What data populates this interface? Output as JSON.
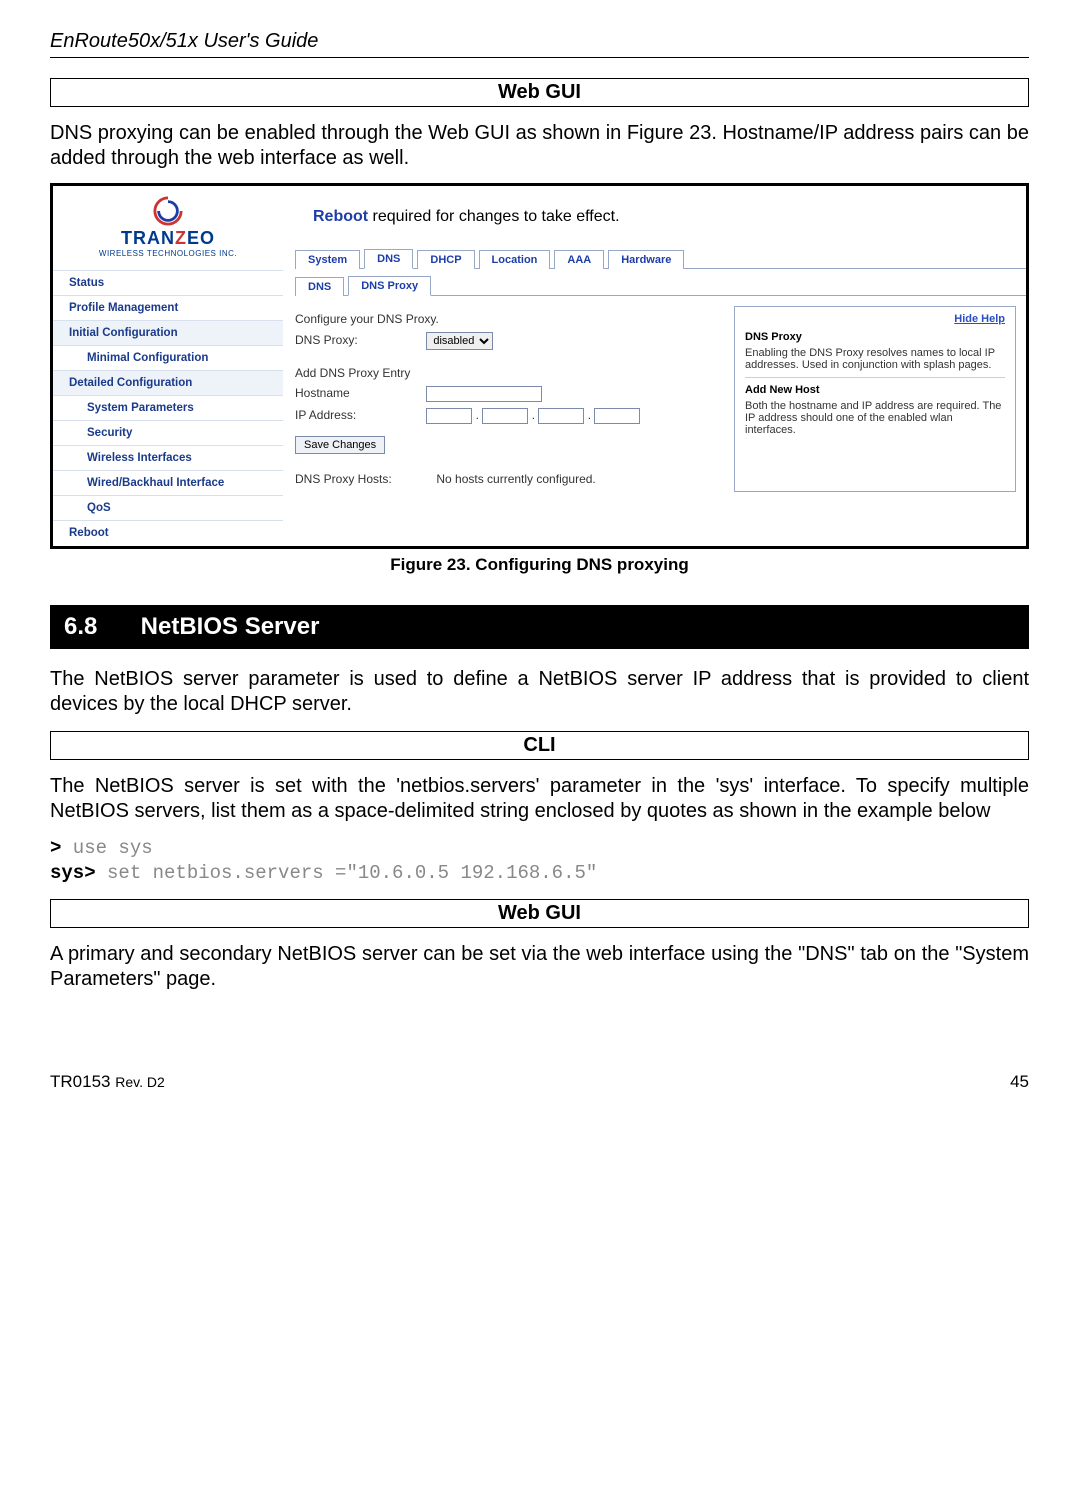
{
  "doc": {
    "header": "EnRoute50x/51x User's Guide",
    "footer_left": "TR0153",
    "footer_rev": "Rev. D2",
    "footer_page": "45"
  },
  "box_webgui": "Web GUI",
  "box_cli": "CLI",
  "p1": "DNS proxying can be enabled through the Web GUI as shown in Figure 23. Hostname/IP address pairs can be added through the web interface as well.",
  "fig_caption": "Figure 23. Configuring DNS proxying",
  "section": {
    "num": "6.8",
    "title": "NetBIOS Server"
  },
  "p2": "The NetBIOS server parameter is used to define a NetBIOS server  IP address that is provided to client devices by the local DHCP server.",
  "p3": "The NetBIOS server is set with the 'netbios.servers' parameter in the 'sys' interface. To specify multiple NetBIOS servers, list them as a space-delimited string enclosed by quotes as shown in the example below",
  "cli": {
    "l1_prompt": ">",
    "l1_cmd": " use sys",
    "l2_prompt": "sys>",
    "l2_cmd": " set netbios.servers =\"10.6.0.5 192.168.6.5\""
  },
  "p4": "A primary and secondary NetBIOS server can be set via the web interface using the \"DNS\" tab on the \"System Parameters\" page.",
  "shot": {
    "logo": {
      "brand_a": "TRAN",
      "brand_b": "Z",
      "brand_c": "EO",
      "sub": "WIRELESS  TECHNOLOGIES INC."
    },
    "nav": [
      {
        "label": "Status",
        "cls": ""
      },
      {
        "label": "Profile Management",
        "cls": ""
      },
      {
        "label": "Initial Configuration",
        "cls": "head"
      },
      {
        "label": "Minimal Configuration",
        "cls": "sub"
      },
      {
        "label": "Detailed Configuration",
        "cls": "head"
      },
      {
        "label": "System Parameters",
        "cls": "sub"
      },
      {
        "label": "Security",
        "cls": "sub"
      },
      {
        "label": "Wireless Interfaces",
        "cls": "sub"
      },
      {
        "label": "Wired/Backhaul Interface",
        "cls": "sub"
      },
      {
        "label": "QoS",
        "cls": "sub"
      },
      {
        "label": "Reboot",
        "cls": ""
      }
    ],
    "banner_word": "Reboot",
    "banner_rest": " required for changes to take effect.",
    "tabs": [
      "System",
      "DNS",
      "DHCP",
      "Location",
      "AAA",
      "Hardware"
    ],
    "tabs_active": "DNS",
    "subtabs": [
      "DNS",
      "DNS Proxy"
    ],
    "subtabs_active": "DNS Proxy",
    "form": {
      "intro": "Configure your DNS Proxy.",
      "proxy_label": "DNS Proxy:",
      "proxy_value": "disabled",
      "add_title": "Add DNS Proxy Entry",
      "hostname_label": "Hostname",
      "ip_label": "IP Address:",
      "save": "Save Changes",
      "hosts_label": "DNS Proxy Hosts:",
      "hosts_value": "No hosts currently configured."
    },
    "help": {
      "hide": "Hide Help",
      "h1": "DNS Proxy",
      "p1": "Enabling the DNS Proxy resolves names to local IP addresses. Used in conjunction with splash pages.",
      "h2": "Add New Host",
      "p2": "Both the hostname and IP address are required. The IP address should one of the enabled wlan interfaces."
    }
  }
}
